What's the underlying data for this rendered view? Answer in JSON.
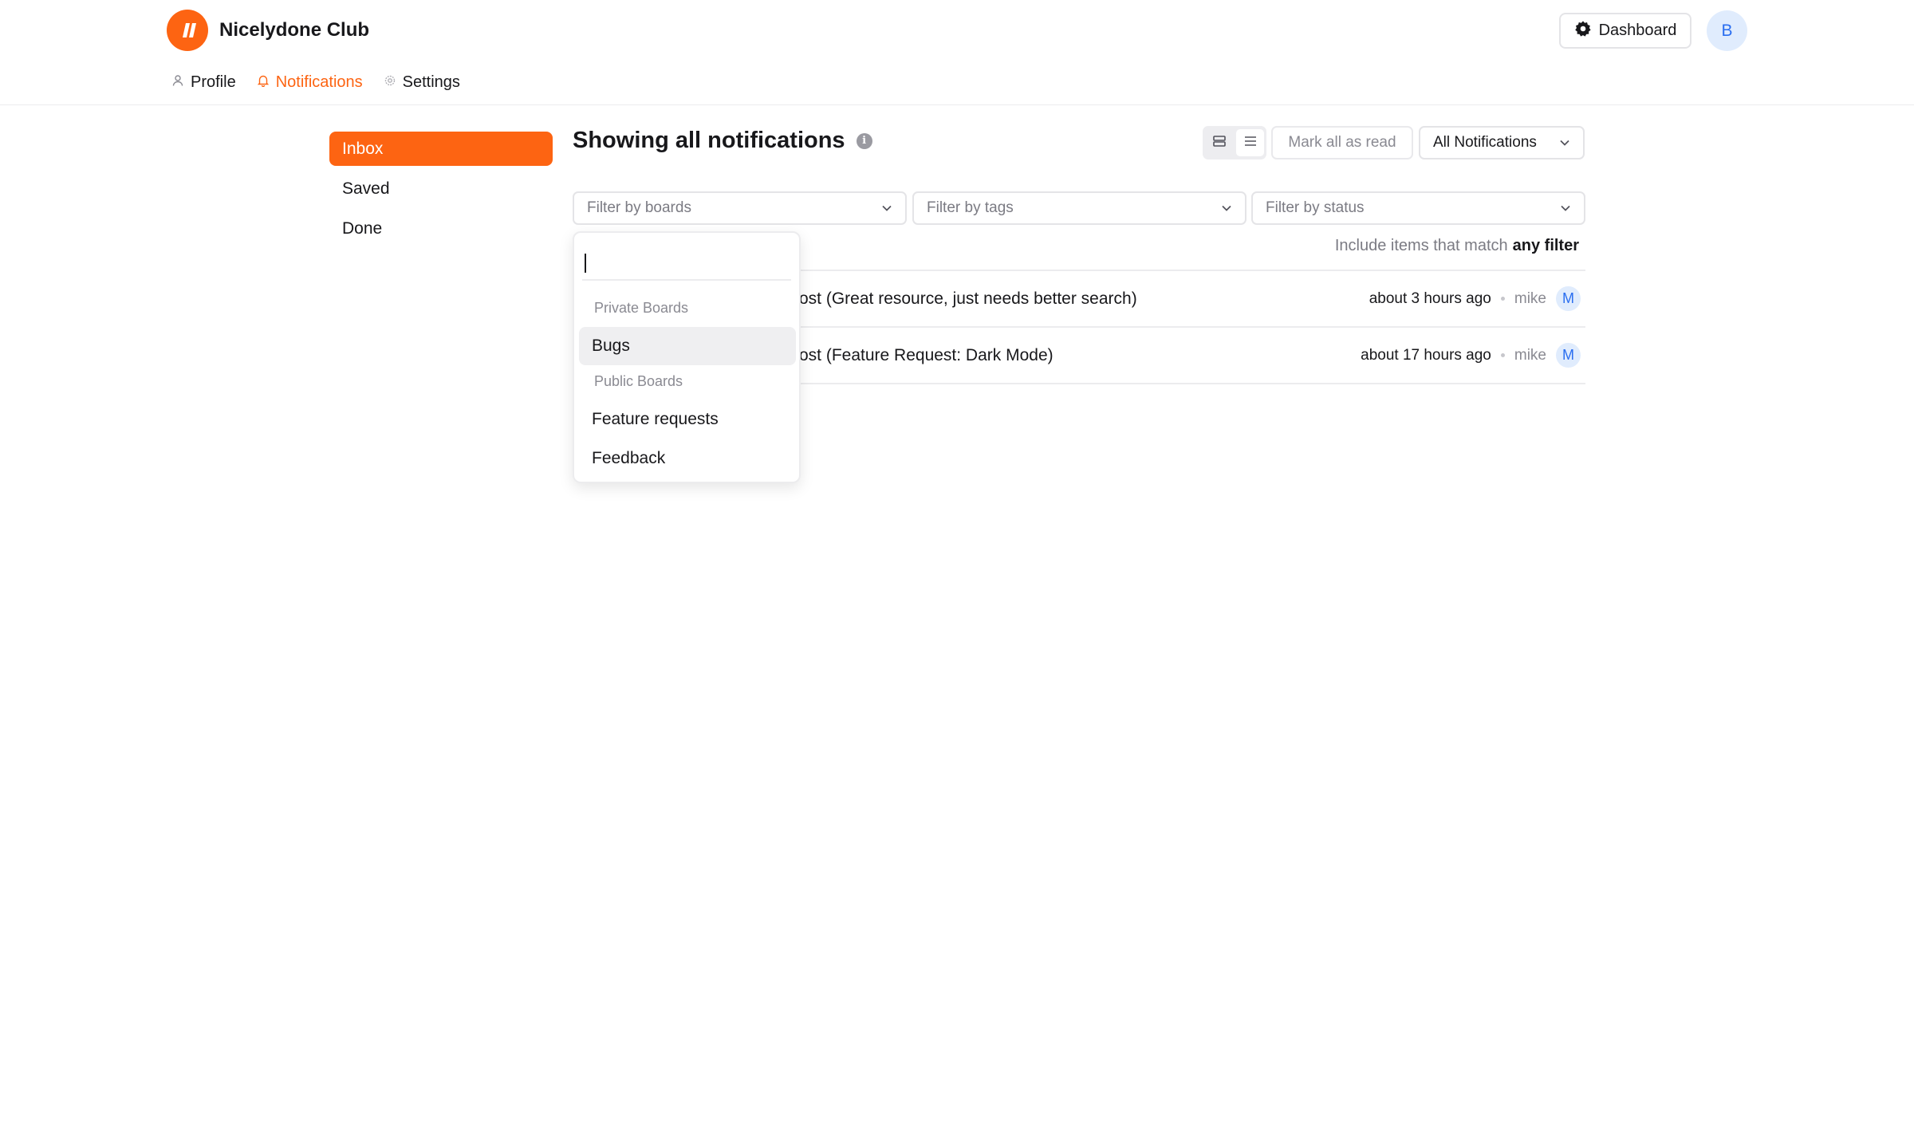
{
  "header": {
    "brand_name": "Nicelydone Club",
    "dashboard_label": "Dashboard",
    "avatar_initial": "B"
  },
  "nav": {
    "profile": "Profile",
    "notifications": "Notifications",
    "settings": "Settings"
  },
  "sidebar": {
    "items": [
      {
        "label": "Inbox",
        "active": true
      },
      {
        "label": "Saved",
        "active": false
      },
      {
        "label": "Done",
        "active": false
      }
    ]
  },
  "main": {
    "title": "Showing all notifications",
    "info_glyph": "i",
    "mark_all_label": "Mark all as read",
    "filter_select": "All Notifications",
    "filters": {
      "boards": "Filter by boards",
      "tags": "Filter by tags",
      "status": "Filter by status"
    },
    "match_prefix": "Include items that match",
    "match_mode": "any filter",
    "notifications": [
      {
        "text": "ost (Great resource, just needs better search)",
        "time": "about 3 hours ago",
        "user": "mike",
        "avatar": "M"
      },
      {
        "text": "ost (Feature Request: Dark Mode)",
        "time": "about 17 hours ago",
        "user": "mike",
        "avatar": "M"
      }
    ]
  },
  "dropdown": {
    "search_value": "",
    "groups": [
      {
        "label": "Private Boards",
        "items": [
          "Bugs"
        ]
      },
      {
        "label": "Public Boards",
        "items": [
          "Feature requests",
          "Feedback"
        ]
      }
    ],
    "highlighted": "Bugs"
  },
  "colors": {
    "accent": "#fd6412",
    "avatar_bg": "#e0ecfd",
    "avatar_text": "#2a6ef0"
  },
  "icons": {
    "logo": "brand-logo-icon",
    "dashboard": "gear-icon",
    "profile": "user-icon",
    "notifications": "bell-icon",
    "settings": "gear-icon",
    "info": "info-icon",
    "chevron": "chevron-down-icon",
    "view_cards": "card-view-icon",
    "view_list": "list-view-icon"
  }
}
